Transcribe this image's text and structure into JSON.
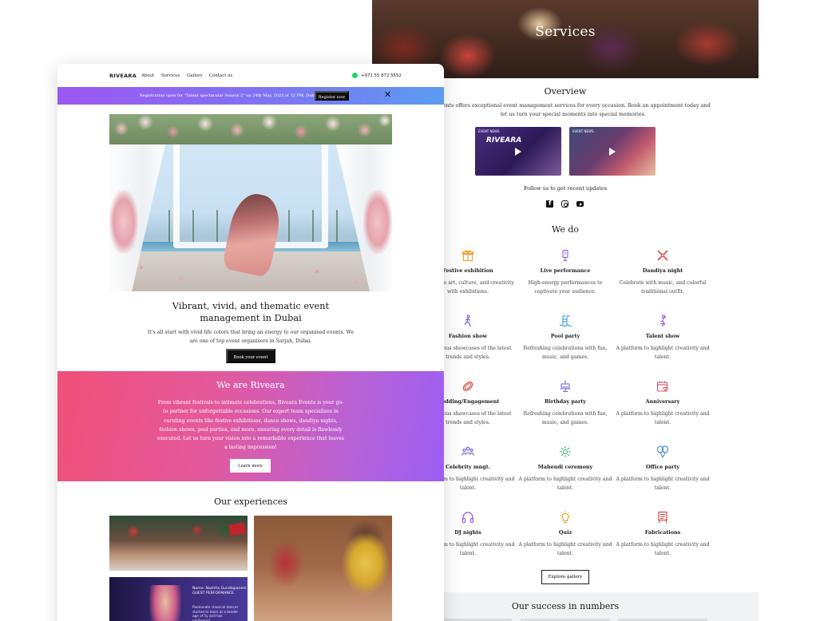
{
  "services_page": {
    "hero_title": "Services",
    "overview_title": "Overview",
    "overview_text": "Events offers exceptional event management services for every occasion. Book an appointment today and let us turn your special moments into special memories.",
    "videos": [
      {
        "brand": "RIVEARA",
        "tag": "EVENT NEWS"
      },
      {
        "brand": "",
        "tag": "EVENT NEWS"
      }
    ],
    "follow_label": "Follow us to get recent updates",
    "social_icons": [
      "facebook-icon",
      "instagram-icon",
      "youtube-icon"
    ],
    "we_do_title": "We do",
    "services": [
      {
        "title": "Festive exhibition",
        "desc": "Showcase art, culture, and creativity with exhibitions.",
        "icon": "gift-icon",
        "color": "#f0a030"
      },
      {
        "title": "Live performance",
        "desc": "High-energy performances to captivate your audience.",
        "icon": "microphone-icon",
        "color": "#9b6bd6"
      },
      {
        "title": "Dandiya night",
        "desc": "Celebrate with music, and colorful traditional outfit.",
        "icon": "dandiya-sticks-icon",
        "color": "#e84848"
      },
      {
        "title": "Fashion show",
        "desc": "Glamorous showcases of the latest trends and styles.",
        "icon": "runway-model-icon",
        "color": "#6a5ad8"
      },
      {
        "title": "Pool party",
        "desc": "Refreshing celebrations with fun, music, and games.",
        "icon": "pool-ladder-icon",
        "color": "#3aa0d8"
      },
      {
        "title": "Talent show",
        "desc": "A platform to highlight creativity and talent.",
        "icon": "dancer-icon",
        "color": "#a04ad8"
      },
      {
        "title": "Wedding/Engagement",
        "desc": "Glamorous showcases of the latest trends and styles.",
        "icon": "rings-icon",
        "color": "#e05040"
      },
      {
        "title": "Birthday party",
        "desc": "Refreshing celebrations with fun, music, and games.",
        "icon": "birthday-cake-icon",
        "color": "#7a6ad8"
      },
      {
        "title": "Anniversary",
        "desc": "A platform to highlight creativity and talent.",
        "icon": "calendar-heart-icon",
        "color": "#e05060"
      },
      {
        "title": "Celebrity mngt.",
        "desc": "A platform to highlight creativity and talent.",
        "icon": "people-group-icon",
        "color": "#6a5ad8"
      },
      {
        "title": "Mahendi ceremony",
        "desc": "A platform to highlight creativity and talent.",
        "icon": "mehndi-pattern-icon",
        "color": "#3ab870"
      },
      {
        "title": "Office party",
        "desc": "A platform to highlight creativity and talent.",
        "icon": "balloons-icon",
        "color": "#3a80d8"
      },
      {
        "title": "DJ nights",
        "desc": "A platform to highlight creativity and talent.",
        "icon": "headphones-icon",
        "color": "#9a4ad0"
      },
      {
        "title": "Quiz",
        "desc": "A platform to highlight creativity and talent.",
        "icon": "lightbulb-icon",
        "color": "#e0a020"
      },
      {
        "title": "Fabrications",
        "desc": "A platform to highlight creativity and talent.",
        "icon": "banner-stand-icon",
        "color": "#d83a3a"
      }
    ],
    "explore_label": "Explore gallery",
    "numbers_title": "Our success in numbers"
  },
  "home_page": {
    "nav": {
      "logo": "RIVEARA",
      "links": [
        "About",
        "Services",
        "Gallery",
        "Contact us"
      ],
      "phone": "+971 55 872 5552"
    },
    "banner": {
      "text": "Registration open for \"Talent spectacular Season 2\" on 24th May, 2025 at 12 PM, Dubai",
      "button": "Register now",
      "close": "✕"
    },
    "hero": {
      "title": "Vibrant, vivid, and thematic event management in Dubai",
      "text": "It's all start with vivid life colors that bring an energy to our organised events. We are one of top event organisers in Sarjah, Dubai.",
      "button": "Book your event"
    },
    "about": {
      "title": "We are Riveara",
      "text": "From vibrant festivals to intimate celebrations, Riveara Events is your go-to partner for unforgettable occasions. Our expert team specializes in curating events like festive exhibitions, dance shows, dandiya nights, fashion shows, pool parties, and more, ensuring every detail is flawlessly executed. Let us turn your vision into a remarkable experience that leaves a lasting impression!",
      "button": "Learn more"
    },
    "experiences": {
      "title": "Our experiences",
      "photo2_name": "Name: Nashita Gundlapaneni",
      "photo2_role": "GUEST PERFORMANCE",
      "photo2_note": "Passionate classical dancer started to learn at a tender age of 5y and has performed..."
    }
  }
}
